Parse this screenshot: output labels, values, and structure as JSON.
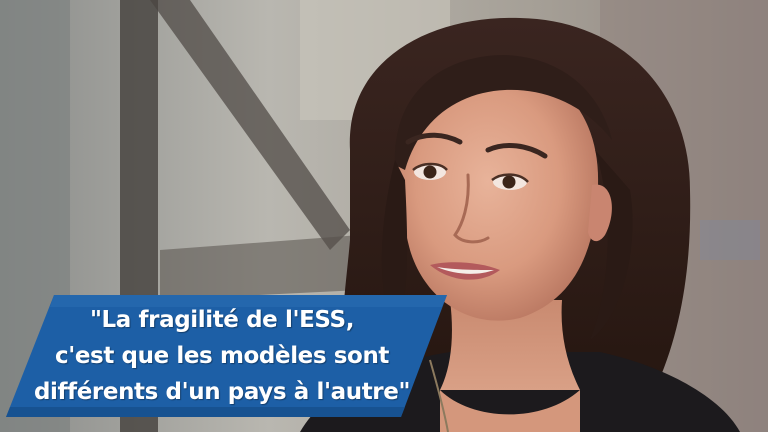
{
  "image": {
    "subject": "woman-portrait"
  },
  "quote": {
    "lines": [
      "\"La fragilité de l'ESS,",
      "c'est que les modèles sont",
      "différents d'un pays à l'autre\""
    ]
  },
  "colors": {
    "banner": "#1d5fa6",
    "banner_edge": "#174f8c",
    "text": "#ffffff"
  }
}
